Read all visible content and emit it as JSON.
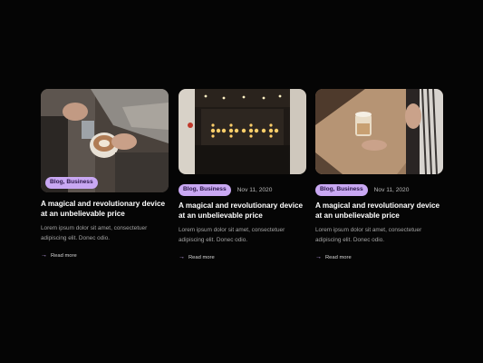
{
  "posts": [
    {
      "image": "latte-art-photo",
      "category": "Blog, Business",
      "date": "",
      "title": "A magical and revolutionary device at an unbelievable price",
      "excerpt": "Lorem ipsum dolor sit amet, consectetuer adipiscing elit. Donec odio.",
      "cta": "Read more"
    },
    {
      "image": "cafe-neon-sign-photo",
      "category": "Blog, Business",
      "date": "Nov 11, 2020",
      "title": "A magical and revolutionary device at an unbelievable price",
      "excerpt": "Lorem ipsum dolor sit amet, consectetuer adipiscing elit. Donec odio.",
      "cta": "Read more"
    },
    {
      "image": "iced-coffee-photo",
      "category": "Blog, Business",
      "date": "Nov 11, 2020",
      "title": "A magical and revolutionary device at an unbelievable price",
      "excerpt": "Lorem ipsum dolor sit amet, consectetuer adipiscing elit. Donec odio.",
      "cta": "Read more"
    }
  ],
  "colors": {
    "background": "#050505",
    "badge": "#c9a8f3",
    "badge_text": "#2a1648"
  }
}
